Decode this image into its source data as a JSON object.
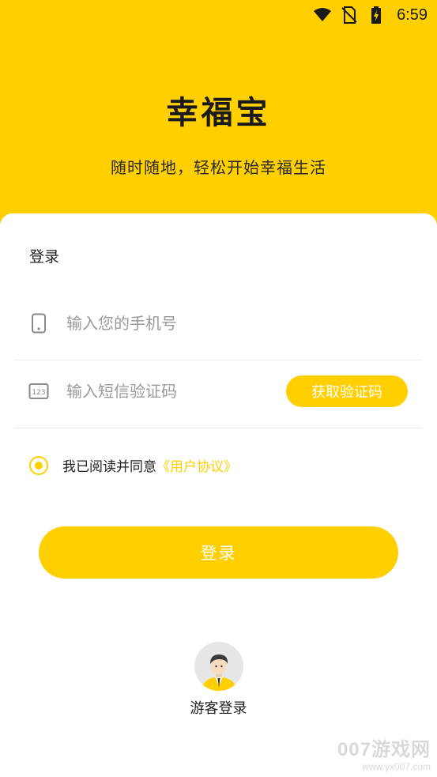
{
  "status_bar": {
    "time": "6:59",
    "icons": [
      "wifi-icon",
      "no-sim-icon",
      "battery-charging-icon"
    ]
  },
  "header": {
    "app_name": "幸福宝",
    "slogan": "随时随地，轻松开始幸福生活"
  },
  "login_card": {
    "title": "登录",
    "phone_field": {
      "placeholder": "输入您的手机号",
      "value": "",
      "icon": "phone-icon"
    },
    "code_field": {
      "placeholder": "输入短信验证码",
      "value": "",
      "icon": "number-pad-icon"
    },
    "get_code_label": "获取验证码",
    "agreement": {
      "text": "我已阅读并同意",
      "link": "《用户协议》",
      "checked": true
    },
    "login_label": "登录",
    "guest_label": "游客登录"
  },
  "watermark": {
    "line1": "007游戏网",
    "line2": "www.yx007.com"
  },
  "colors": {
    "brand_yellow": "#FFCF00",
    "text_dark": "#222222",
    "placeholder": "#9a9a9a"
  }
}
